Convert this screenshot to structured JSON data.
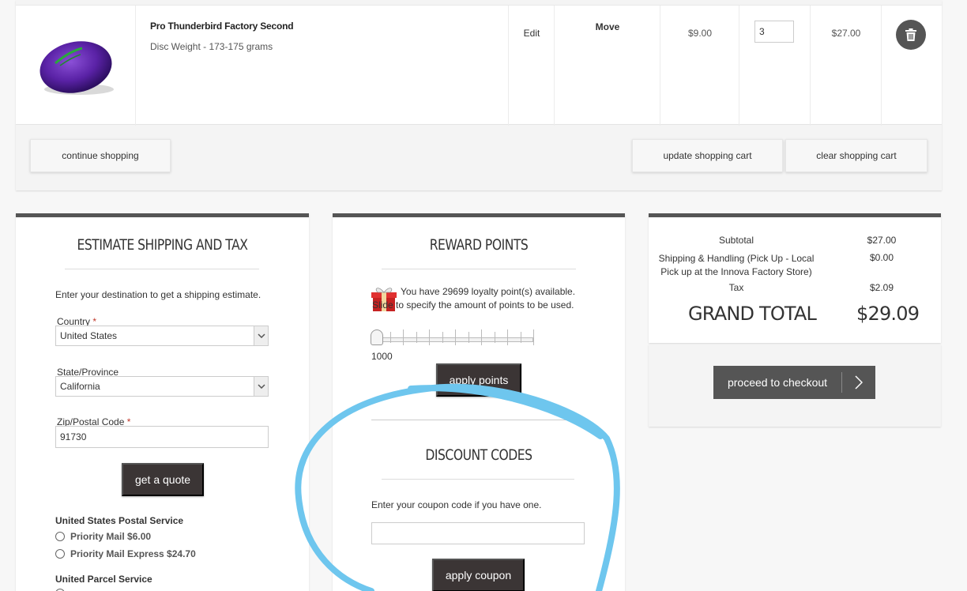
{
  "cart": {
    "item": {
      "name": "Pro Thunderbird Factory Second",
      "option": "Disc Weight - 173-175 grams",
      "edit_label": "Edit",
      "move_label": "Move",
      "price": "$9.00",
      "qty": "3",
      "subtotal": "$27.00",
      "image_icon": "purple-disc-image"
    },
    "continue_label": "continue shopping",
    "update_label": "update shopping cart",
    "clear_label": "clear shopping cart"
  },
  "shipping": {
    "title": "ESTIMATE SHIPPING AND TAX",
    "intro": "Enter your destination to get a shipping estimate.",
    "country_label": "Country",
    "country_value": "United States",
    "state_label": "State/Province",
    "state_value": "California",
    "zip_label": "Zip/Postal Code",
    "zip_value": "91730",
    "required_mark": "*",
    "quote_label": "get a quote",
    "carrier_usps": "United States Postal Service",
    "opt_priority": "Priority Mail $6.00",
    "opt_express": "Priority Mail Express $24.70",
    "carrier_ups": "United Parcel Service"
  },
  "rewards": {
    "title": "REWARD POINTS",
    "message": "You have 29699 loyalty point(s) available. Slide to specify the amount of points to be used.",
    "slider_value": "1000",
    "apply_label": "apply points"
  },
  "discount": {
    "title": "DISCOUNT CODES",
    "prompt": "Enter your coupon code if you have one.",
    "coupon_value": "",
    "apply_label": "apply coupon"
  },
  "totals": {
    "subtotal_label": "Subtotal",
    "subtotal_value": "$27.00",
    "shipping_label": "Shipping & Handling (Pick Up - Local Pick up at the Innova Factory Store)",
    "shipping_value": "$0.00",
    "tax_label": "Tax",
    "tax_value": "$2.09",
    "grand_label": "GRAND TOTAL",
    "grand_value": "$29.09",
    "checkout_label": "proceed to checkout"
  },
  "colors": {
    "annotation": "#6ec6ee",
    "dark_button": "#3b3535",
    "panel_top": "#555555"
  }
}
